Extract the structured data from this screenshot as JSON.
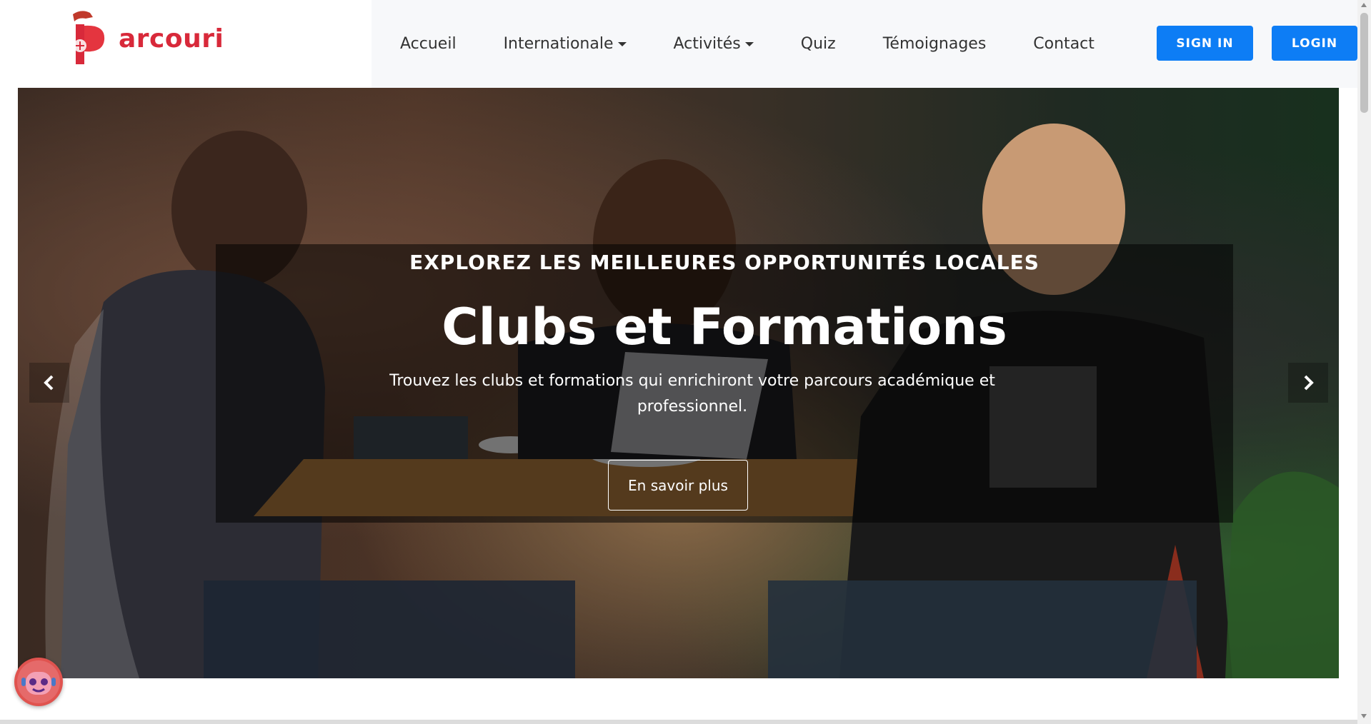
{
  "brand": {
    "name": "arcouri",
    "color": "#d8293a"
  },
  "nav": {
    "items": [
      {
        "label": "Accueil",
        "dropdown": false
      },
      {
        "label": "Internationale",
        "dropdown": true
      },
      {
        "label": "Activités",
        "dropdown": true
      },
      {
        "label": "Quiz",
        "dropdown": false
      },
      {
        "label": "Témoignages",
        "dropdown": false
      },
      {
        "label": "Contact",
        "dropdown": false
      }
    ],
    "signin_label": "SIGN IN",
    "login_label": "LOGIN",
    "accent": "#0d7df5"
  },
  "hero": {
    "eyebrow": "EXPLOREZ LES MEILLEURES OPPORTUNITÉS LOCALES",
    "title": "Clubs et Formations",
    "description": "Trouvez les clubs et formations qui enrichiront votre parcours académique et professionnel.",
    "cta_label": "En savoir plus",
    "prev_icon": "chevron-left-icon",
    "next_icon": "chevron-right-icon"
  },
  "chatbot": {
    "icon": "robot-icon"
  }
}
